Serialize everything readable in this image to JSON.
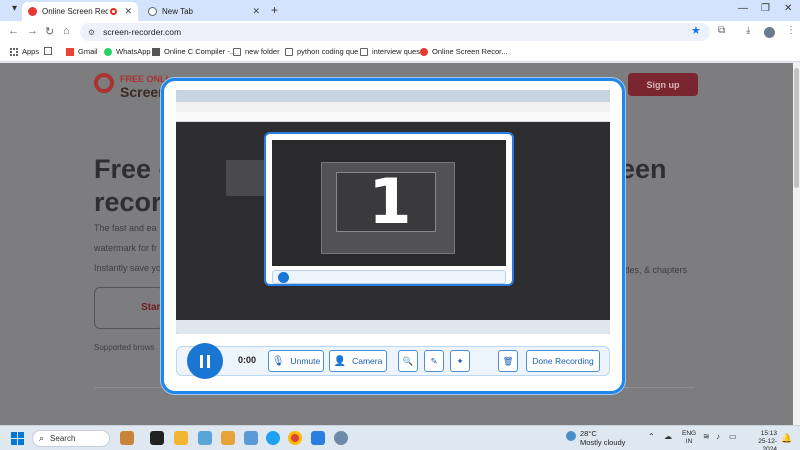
{
  "tabs": [
    {
      "label": "Online Screen Recorder",
      "favicon_color": "#e53935",
      "active": true
    },
    {
      "label": "New Tab",
      "favicon_color": "#5f6368",
      "active": false
    }
  ],
  "url": "screen-recorder.com",
  "bookmarks": [
    "Apps",
    "Gmail",
    "WhatsApp",
    "Online C Compiler -...",
    "new folder",
    "python coding que",
    "interview ques",
    "Online Screen Recor..."
  ],
  "page": {
    "logo_line1": "FREE ONLI",
    "logo_line2": "Screen",
    "signup": "Sign up",
    "headline_line1": "Free o",
    "headline_line2": "recor",
    "headline_right1": "een",
    "para_line1": "The fast and ea",
    "para_line2": "watermark for fr",
    "para_line3": "Instantly save yo",
    "para_right2": "e",
    "para_right3": "tles, & chapters",
    "start_btn": "Star",
    "supported": "Supported brows"
  },
  "recorder": {
    "countdown": "1",
    "timer": "0:00",
    "unmute_label": "Unmute",
    "camera_label": "Camera",
    "done_label": "Done Recording"
  },
  "taskbar": {
    "search_label": "Search",
    "weather_temp": "28°C",
    "weather_desc": "Mostly cloudy",
    "lang1": "ENG",
    "lang2": "IN",
    "time": "15:13",
    "date": "25-12-2024"
  },
  "colors": {
    "accent": "#1976d2",
    "modal_border": "#2286e8",
    "brand_red": "#e53935"
  }
}
